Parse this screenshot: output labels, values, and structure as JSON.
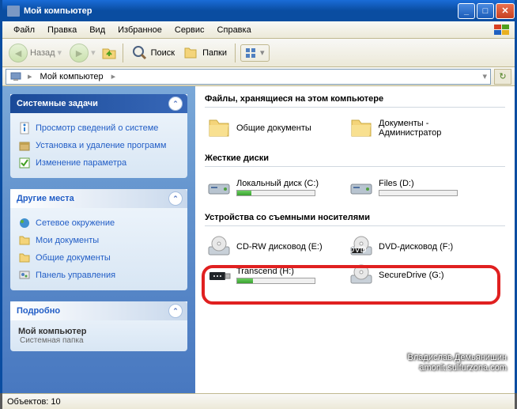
{
  "title": "Мой компьютер",
  "menu": [
    "Файл",
    "Правка",
    "Вид",
    "Избранное",
    "Сервис",
    "Справка"
  ],
  "toolbar": {
    "back": "Назад",
    "search": "Поиск",
    "folders": "Папки"
  },
  "address": {
    "root": "Мой компьютер"
  },
  "sidebar": {
    "system": {
      "title": "Системные задачи",
      "items": [
        "Просмотр сведений о системе",
        "Установка и удаление программ",
        "Изменение параметра"
      ]
    },
    "other": {
      "title": "Другие места",
      "items": [
        "Сетевое окружение",
        "Мои документы",
        "Общие документы",
        "Панель управления"
      ]
    },
    "details": {
      "title": "Подробно",
      "name": "Мой компьютер",
      "type": "Системная папка"
    }
  },
  "sections": {
    "stored": {
      "title": "Файлы, хранящиеся на этом компьютере",
      "items": [
        "Общие документы",
        "Документы - Администратор"
      ]
    },
    "hdd": {
      "title": "Жесткие диски",
      "items": [
        {
          "label": "Локальный диск (C:)",
          "fill": 18
        },
        {
          "label": "Files (D:)",
          "fill": 0
        }
      ]
    },
    "removable": {
      "title": "Устройства со съемными носителями",
      "items": [
        {
          "label": "CD-RW дисковод (E:)"
        },
        {
          "label": "DVD-дисковод (F:)"
        },
        {
          "label": "Transcend (H:)",
          "fill": 20
        },
        {
          "label": "SecureDrive (G:)"
        }
      ]
    }
  },
  "status": "Объектов: 10",
  "watermark": {
    "l1": "Владислав Демьянишин",
    "l2": "amonit.sulfurzona.com"
  }
}
